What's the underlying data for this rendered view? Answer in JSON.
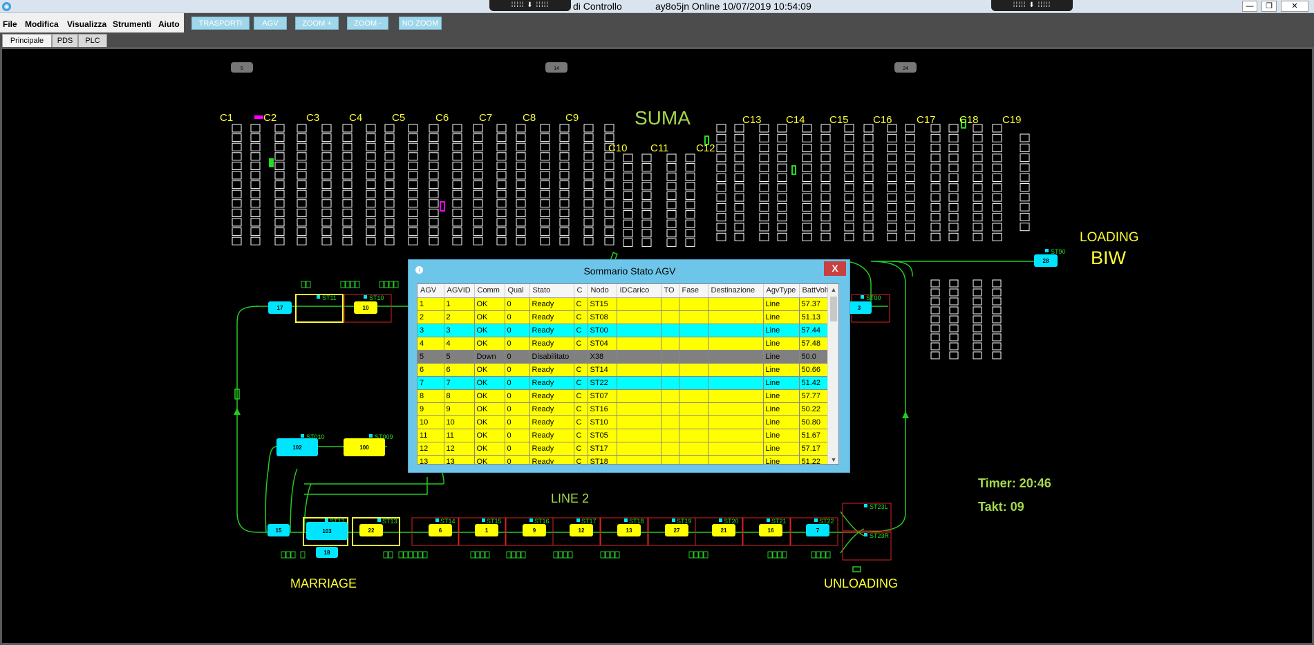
{
  "window": {
    "title_partial": "di Controllo",
    "status": "ay8o5jn Online 10/07/2019 10:54:09",
    "ribbon_glyph": "⁞⁞⁞⁞⁞ ⬇ ⁞⁞⁞⁞⁞",
    "controls": [
      "—",
      "❐",
      "✕"
    ]
  },
  "menu": [
    "File",
    "Modifica",
    "Visualizza",
    "Strumenti",
    "Aiuto"
  ],
  "toolbar": [
    "TRASPORTI",
    "AGV",
    "ZOOM +",
    "ZOOM -",
    "NO ZOOM"
  ],
  "tabs": [
    "Principale",
    "PDS",
    "PLC"
  ],
  "map": {
    "title_suma": "SUMA",
    "line2": "LINE 2",
    "marriage": "MARRIAGE",
    "unloading": "UNLOADING",
    "loading": "LOADING",
    "biw": "BIW",
    "timer": "Timer: 20:46",
    "takt": "Takt: 09",
    "top_markers": [
      "5",
      "14",
      "24"
    ],
    "columns_left": [
      "C1",
      "C2",
      "C3",
      "C4",
      "C5",
      "C6",
      "C7",
      "C8",
      "C9"
    ],
    "columns_mid": [
      "C10",
      "C11",
      "C12"
    ],
    "columns_right": [
      "C13",
      "C14",
      "C15",
      "C16",
      "C17",
      "C18",
      "C19"
    ],
    "stations_top": [
      "ST11",
      "ST10",
      "ST00",
      "ST90"
    ],
    "stations_bottom": [
      "ST12",
      "ST13",
      "ST14",
      "ST15",
      "ST16",
      "ST17",
      "ST18",
      "ST19",
      "ST20",
      "ST21",
      "ST22"
    ],
    "stations_right": [
      "ST23L",
      "ST23R"
    ],
    "stations_left": [
      "ST010",
      "ST009"
    ],
    "agv_bottom": [
      "6",
      "1",
      "9",
      "12",
      "13",
      "27",
      "21",
      "16",
      "7"
    ],
    "agv_marriage": [
      "15",
      "103",
      "22",
      "18"
    ],
    "agv_top": [
      "17",
      "10",
      "3",
      "28"
    ],
    "agv_mid": [
      "102",
      "100"
    ]
  },
  "dialog": {
    "title": "Sommario Stato AGV",
    "close": "X",
    "icon": "i",
    "scroll_up": "▲",
    "scroll_down": "▼",
    "columns": [
      "AGV",
      "AGVID",
      "Comm",
      "Qual",
      "Stato",
      "C",
      "Nodo",
      "IDCarico",
      "TO",
      "Fase",
      "Destinazione",
      "AgvType",
      "BattVolt"
    ],
    "rows": [
      {
        "cells": [
          "1",
          "1",
          "OK",
          "0",
          "Ready",
          "C",
          "ST15",
          "",
          "",
          "",
          "",
          "Line",
          "57.37"
        ],
        "color": "#ffff00"
      },
      {
        "cells": [
          "2",
          "2",
          "OK",
          "0",
          "Ready",
          "C",
          "ST08",
          "",
          "",
          "",
          "",
          "Line",
          "51.13"
        ],
        "color": "#ffff00"
      },
      {
        "cells": [
          "3",
          "3",
          "OK",
          "0",
          "Ready",
          "C",
          "ST00",
          "",
          "",
          "",
          "",
          "Line",
          "57.44"
        ],
        "color": "#00ffff"
      },
      {
        "cells": [
          "4",
          "4",
          "OK",
          "0",
          "Ready",
          "C",
          "ST04",
          "",
          "",
          "",
          "",
          "Line",
          "57.48"
        ],
        "color": "#ffff00"
      },
      {
        "cells": [
          "5",
          "5",
          "Down",
          "0",
          "Disabilitato",
          "",
          "X38",
          "",
          "",
          "",
          "",
          "Line",
          "50.0"
        ],
        "color": "#808080"
      },
      {
        "cells": [
          "6",
          "6",
          "OK",
          "0",
          "Ready",
          "C",
          "ST14",
          "",
          "",
          "",
          "",
          "Line",
          "50.66"
        ],
        "color": "#ffff00"
      },
      {
        "cells": [
          "7",
          "7",
          "OK",
          "0",
          "Ready",
          "C",
          "ST22",
          "",
          "",
          "",
          "",
          "Line",
          "51.42"
        ],
        "color": "#00ffff"
      },
      {
        "cells": [
          "8",
          "8",
          "OK",
          "0",
          "Ready",
          "C",
          "ST07",
          "",
          "",
          "",
          "",
          "Line",
          "57.77"
        ],
        "color": "#ffff00"
      },
      {
        "cells": [
          "9",
          "9",
          "OK",
          "0",
          "Ready",
          "C",
          "ST16",
          "",
          "",
          "",
          "",
          "Line",
          "50.22"
        ],
        "color": "#ffff00"
      },
      {
        "cells": [
          "10",
          "10",
          "OK",
          "0",
          "Ready",
          "C",
          "ST10",
          "",
          "",
          "",
          "",
          "Line",
          "50.80"
        ],
        "color": "#ffff00"
      },
      {
        "cells": [
          "11",
          "11",
          "OK",
          "0",
          "Ready",
          "C",
          "ST05",
          "",
          "",
          "",
          "",
          "Line",
          "51.67"
        ],
        "color": "#ffff00"
      },
      {
        "cells": [
          "12",
          "12",
          "OK",
          "0",
          "Ready",
          "C",
          "ST17",
          "",
          "",
          "",
          "",
          "Line",
          "57.17"
        ],
        "color": "#ffff00"
      },
      {
        "cells": [
          "13",
          "13",
          "OK",
          "0",
          "Ready",
          "C",
          "ST18",
          "",
          "",
          "",
          "",
          "Line",
          "51.22"
        ],
        "color": "#ffff00"
      }
    ]
  },
  "colors": {
    "label_yellow": "#ffff33",
    "label_green": "#a6d94a",
    "track": "#22cc22",
    "agv_yellow": "#ffff00",
    "agv_cyan": "#00e5ff",
    "station_red": "#dd2222"
  }
}
